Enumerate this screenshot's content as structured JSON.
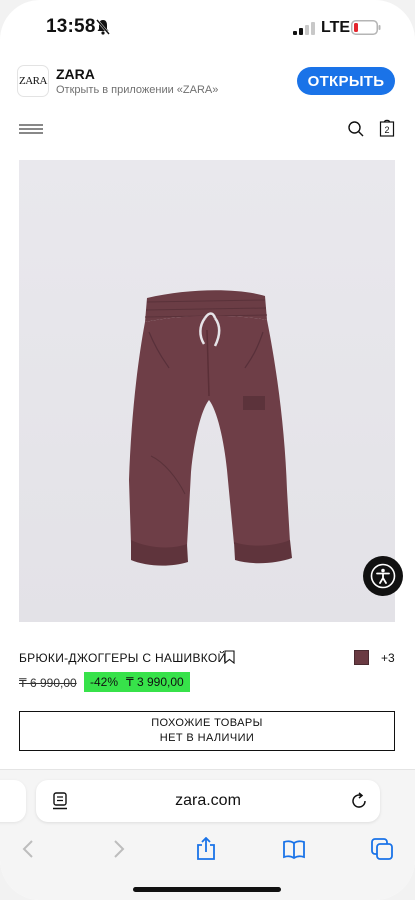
{
  "status_bar": {
    "time": "13:58",
    "network": "LTE"
  },
  "app_banner": {
    "logo_text": "ZARA",
    "app_name": "ZARA",
    "subtitle": "Открыть в приложении «ZARA»",
    "open_label": "ОТКРЫТЬ"
  },
  "header": {
    "bag_count": "2"
  },
  "product": {
    "title": "БРЮКИ-ДЖОГГЕРЫ С НАШИВКОЙ",
    "more_colors": "+3",
    "old_price": "₸ 6 990,00",
    "discount": "-42%",
    "new_price": "₸ 3 990,00",
    "swatch_color": "#6a3a42"
  },
  "similar": {
    "line1": "ПОХОЖИЕ ТОВАРЫ",
    "line2": "НЕТ В НАЛИЧИИ"
  },
  "browser": {
    "url": "zara.com"
  },
  "colors": {
    "accent": "#1a73e8",
    "discount_bg": "#37e24a",
    "toolbar_icon": "#1a73e8"
  }
}
